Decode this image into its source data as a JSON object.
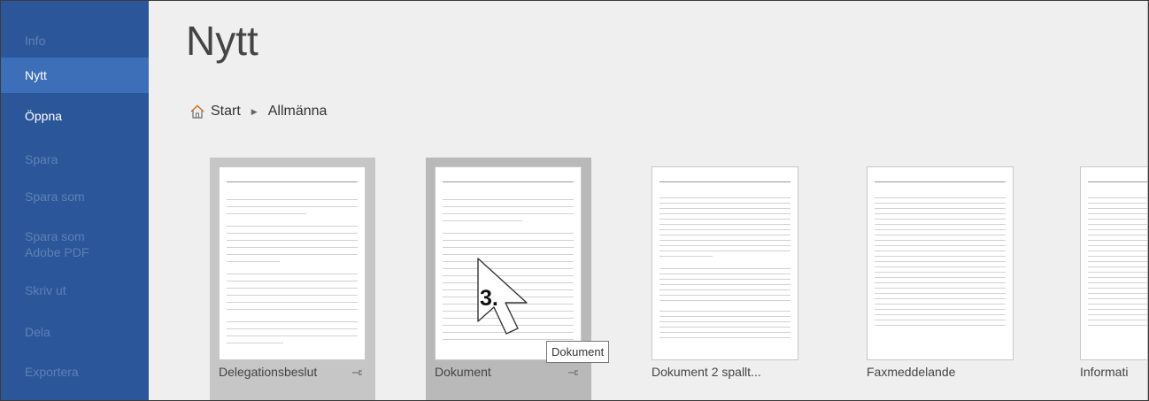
{
  "sidebar": {
    "items": [
      {
        "label": "Info",
        "state": "disabled"
      },
      {
        "label": "Nytt",
        "state": "selected"
      },
      {
        "label": "Öppna",
        "state": "enabled"
      },
      {
        "label": "Spara",
        "state": "disabled"
      },
      {
        "label": "Spara som",
        "state": "disabled"
      },
      {
        "label": "Spara som\nAdobe PDF",
        "state": "disabled"
      },
      {
        "label": "Skriv ut",
        "state": "disabled"
      },
      {
        "label": "Dela",
        "state": "disabled"
      },
      {
        "label": "Exportera",
        "state": "disabled"
      }
    ]
  },
  "main": {
    "title": "Nytt",
    "breadcrumb": {
      "home": "Start",
      "current": "Allmänna"
    },
    "templates": [
      {
        "label": "Delegationsbeslut",
        "pinnable": true
      },
      {
        "label": "Dokument",
        "pinnable": true
      },
      {
        "label": "Dokument 2 spallt...",
        "pinnable": false
      },
      {
        "label": "Faxmeddelande",
        "pinnable": false
      },
      {
        "label": "Informati",
        "pinnable": false
      }
    ],
    "tooltip": "Dokument",
    "step_marker": "3."
  },
  "colors": {
    "sidebar_bg": "#2b579a",
    "sidebar_selected": "#3d6fb8",
    "sidebar_disabled_text": "#5f80b5",
    "template_hover": "#c6c6c6",
    "template_active": "#b9b9b9"
  }
}
